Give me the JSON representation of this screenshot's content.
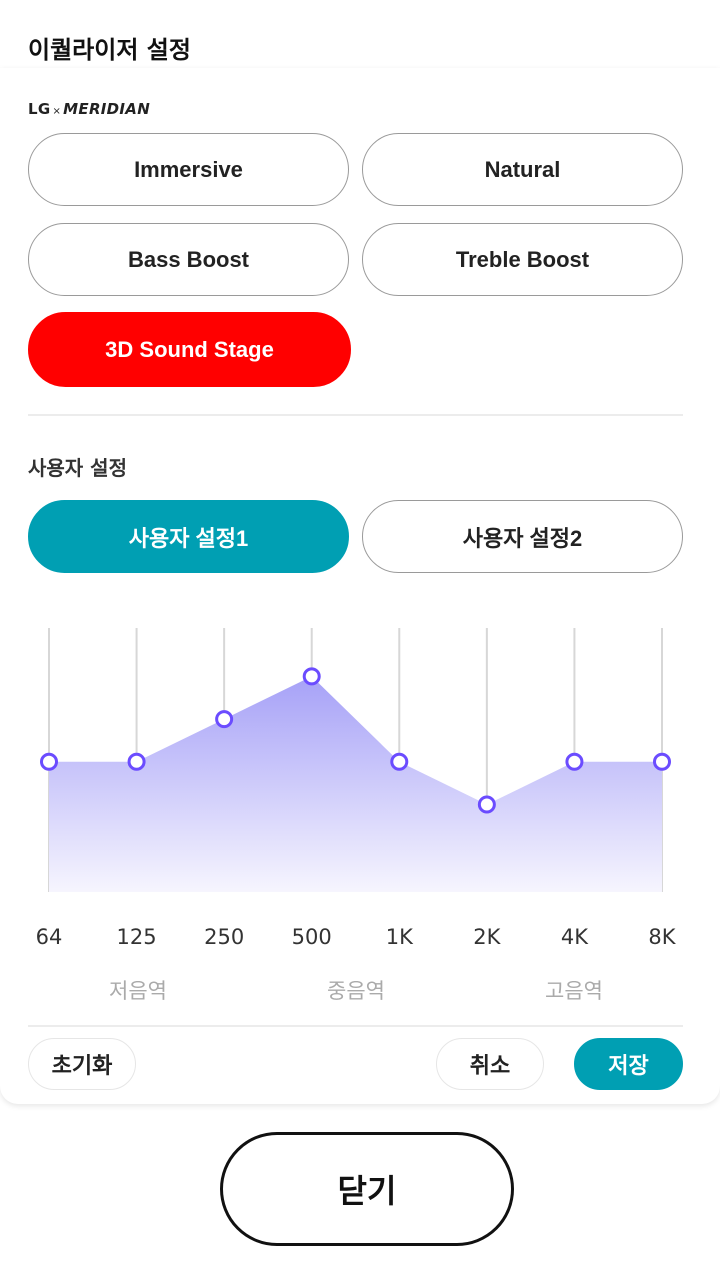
{
  "dialog": {
    "title": "이퀄라이저 설정",
    "brand_lg": "LG",
    "brand_x": "×",
    "brand_meridian": "MERIDIAN"
  },
  "presets": [
    {
      "label": "Immersive",
      "selected": false
    },
    {
      "label": "Natural",
      "selected": false
    },
    {
      "label": "Bass Boost",
      "selected": false
    },
    {
      "label": "Treble Boost",
      "selected": false
    },
    {
      "label": "3D Sound Stage",
      "selected": true
    }
  ],
  "user_settings": {
    "section_label": "사용자 설정",
    "tabs": [
      {
        "label": "사용자 설정1",
        "selected": true
      },
      {
        "label": "사용자 설정2",
        "selected": false
      }
    ]
  },
  "equalizer": {
    "bands": [
      "64",
      "125",
      "250",
      "500",
      "1K",
      "2K",
      "4K",
      "8K"
    ],
    "levels": [
      0.5,
      0.5,
      0.7,
      0.9,
      0.5,
      0.3,
      0.5,
      0.5
    ],
    "ranges": [
      "저음역",
      "중음역",
      "고음역"
    ]
  },
  "footer": {
    "reset_label": "초기화",
    "cancel_label": "취소",
    "save_label": "저장"
  },
  "close_label": "닫기",
  "colors": {
    "accent_red": "#ff0000",
    "accent_teal": "#009fb3",
    "eq_point": "#6b4cff",
    "eq_fill_top": "#a8a4f8",
    "eq_fill_bottom": "#f4f3fe"
  }
}
